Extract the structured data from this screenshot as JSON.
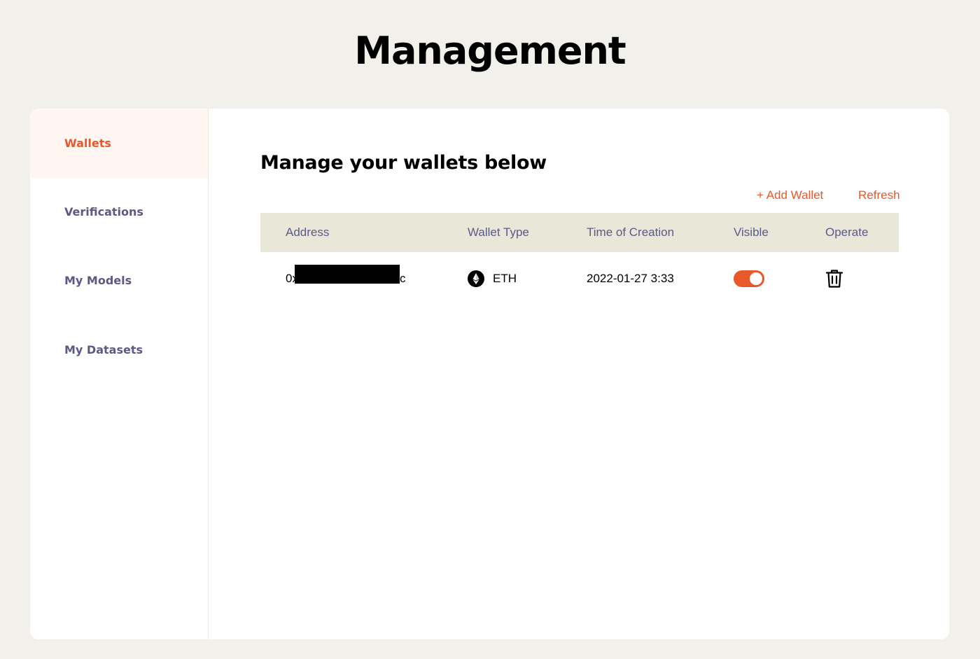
{
  "page": {
    "title": "Management"
  },
  "sidebar": {
    "items": [
      {
        "label": "Wallets",
        "active": true
      },
      {
        "label": "Verifications",
        "active": false
      },
      {
        "label": "My Models",
        "active": false
      },
      {
        "label": "My Datasets",
        "active": false
      }
    ]
  },
  "main": {
    "title": "Manage your wallets below",
    "actions": {
      "add_wallet": "+ Add Wallet",
      "refresh": "Refresh"
    },
    "table": {
      "headers": [
        "Address",
        "Wallet Type",
        "Time of Creation",
        "Visible",
        "Operate"
      ],
      "rows": [
        {
          "address_prefix": "0x",
          "address_suffix": "c",
          "wallet_type": "ETH",
          "wallet_icon": "ethereum-icon",
          "time_of_creation": "2022-01-27 3:33",
          "visible": true,
          "operate_icon": "trash-icon"
        }
      ]
    }
  },
  "colors": {
    "background": "#f2f0eb",
    "accent": "#e9582a",
    "nav_text": "#5b5a86",
    "active_nav_bg": "#fff5f1",
    "table_header_bg": "#e9e7d7"
  }
}
